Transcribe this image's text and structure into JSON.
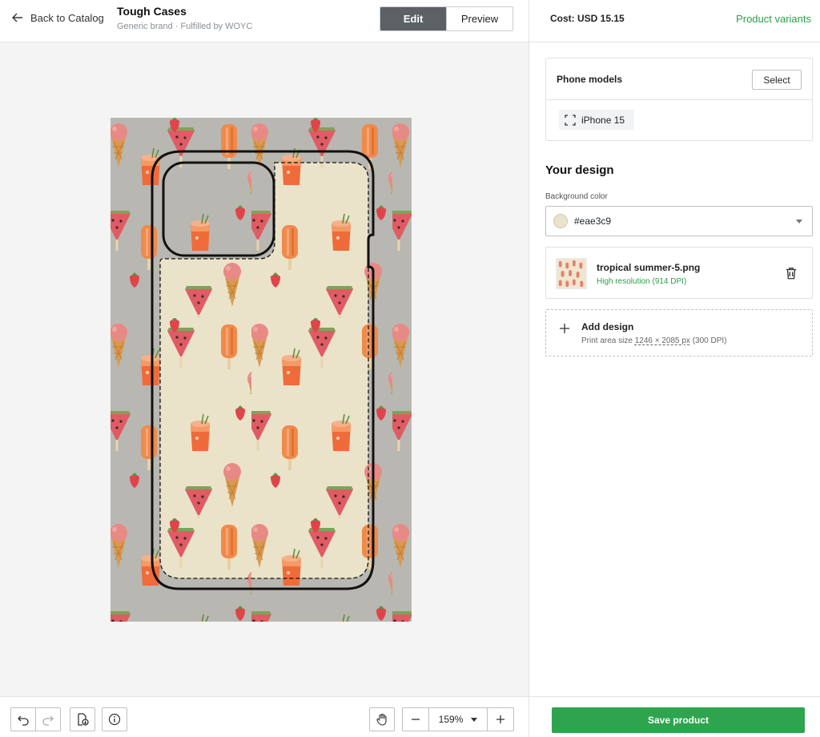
{
  "header": {
    "back_label": "Back to Catalog",
    "title": "Tough Cases",
    "subtitle": "Generic brand · Fulfilled by WOYC",
    "edit_label": "Edit",
    "preview_label": "Preview"
  },
  "panel": {
    "cost": "Cost: USD 15.15",
    "variants_link": "Product variants",
    "phone_models_label": "Phone models",
    "select_label": "Select",
    "selected_model": "iPhone 15",
    "your_design_title": "Your design",
    "bg_color_label": "Background color",
    "bg_color_value": "#eae3c9",
    "file_name": "tropical summer-5.png",
    "file_resolution": "High resolution (914 DPI)",
    "add_design_title": "Add design",
    "print_area_prefix": "Print area size ",
    "print_area_dims": "1246 × 2085 px",
    "print_area_suffix": " (300 DPI)",
    "save_label": "Save product"
  },
  "toolbar": {
    "zoom_value": "159%"
  },
  "colors": {
    "accent_green": "#2ea44f",
    "design_bg": "#eae3c9",
    "case_gray": "#b8b7b1"
  }
}
